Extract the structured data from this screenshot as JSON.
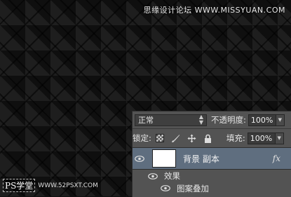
{
  "watermark": {
    "top": "思缘设计论坛 WWW.MISSYUAN.COM",
    "bottom_brand": "PS学堂",
    "bottom_url": "WWW.52PSXT.COM"
  },
  "layers_panel": {
    "blend_mode": "正常",
    "opacity_label": "不透明度:",
    "opacity_value": "100%",
    "lock_label": "锁定:",
    "fill_label": "填充:",
    "fill_value": "100%",
    "layer": {
      "name": "背景 副本",
      "fx_label": "fx"
    },
    "effects_label": "效果",
    "effect_item": "图案叠加"
  },
  "colors": {
    "panel_bg": "#535353",
    "selected_layer": "#5f6e7f"
  }
}
